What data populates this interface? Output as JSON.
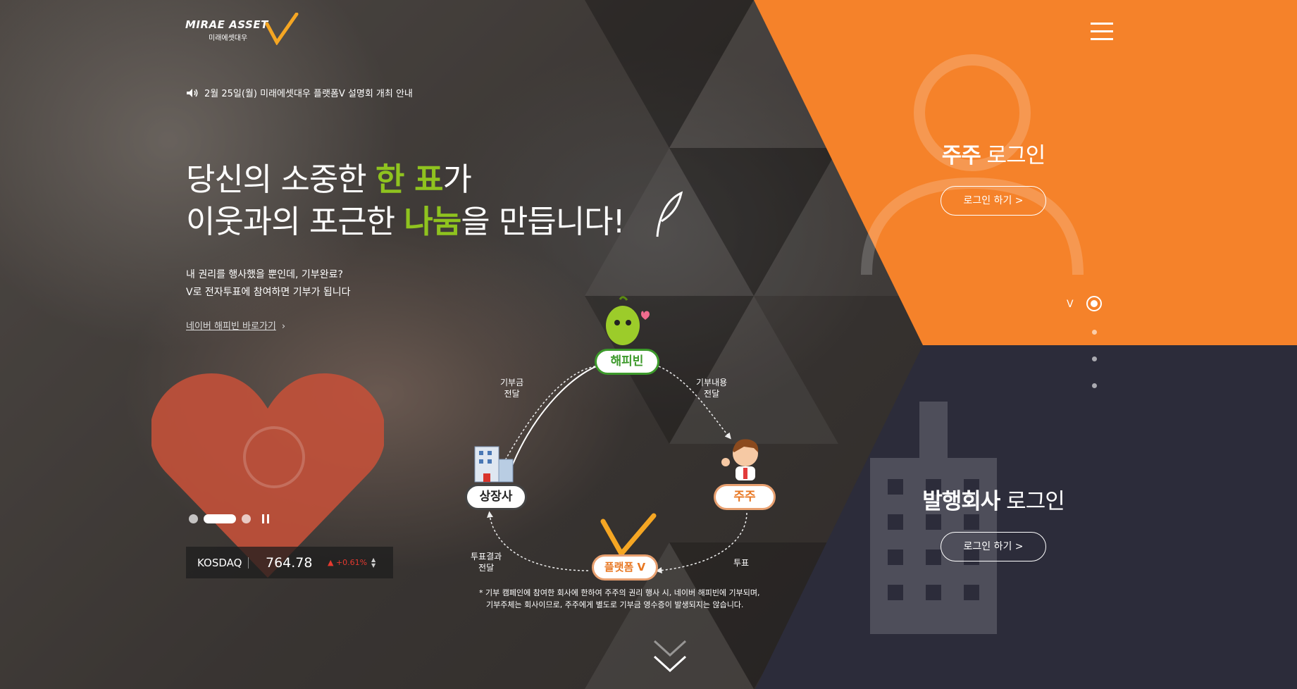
{
  "brand": {
    "logo_text": "MIRAE ASSET",
    "logo_subtext": "미래에셋대우",
    "accent_orange": "#f5822a",
    "accent_green": "#8fc31f",
    "navy": "#2c2c3a"
  },
  "header": {
    "notice": "2월 25일(월) 미래에셋대우 플랫폼V 설명회 개최 안내",
    "menu_icon": "hamburger-icon"
  },
  "hero": {
    "line1_pre": "당신의 소중한 ",
    "line1_hl": "한 표",
    "line1_post": "가",
    "line2_pre": "이웃과의 포근한 ",
    "line2_hl": "나눔",
    "line2_post": "을 만듭니다!",
    "sub1": "내 권리를 행사했을 뿐인데, 기부완료?",
    "sub2": "V로 전자투표에 참여하면 기부가 됩니다",
    "link": "네이버 해피빈 바로가기",
    "link_arrow": "›"
  },
  "ticker": {
    "name": "KOSDAQ",
    "value": "764.78",
    "change": "▲ +0.61%",
    "arrows": "▲▼"
  },
  "diagram": {
    "node_happybean": "해피빈",
    "node_listed": "상장사",
    "node_shareholder": "주주",
    "node_platform": "플랫폼 V",
    "label_donation_1": "기부금",
    "label_donation_2": "전달",
    "label_content_1": "기부내용",
    "label_content_2": "전달",
    "label_result_1": "투표결과",
    "label_result_2": "전달",
    "label_vote": "투표",
    "note_1": "* 기부 캠페인에 참여한 회사에 한하여 주주의 권리 행사 시, 네이버 해피빈에 기부되며,",
    "note_2": "기부주체는 회사이므로, 주주에게 별도로 기부금 영수증이 발생되지는 않습니다."
  },
  "login": {
    "shareholder_bold": "주주",
    "shareholder_rest": " 로그인",
    "shareholder_btn": "로그인 하기  >",
    "issuer_bold": "발행회사",
    "issuer_rest": " 로그인",
    "issuer_btn": "로그인 하기  >"
  },
  "side_nav": {
    "label": "V"
  }
}
